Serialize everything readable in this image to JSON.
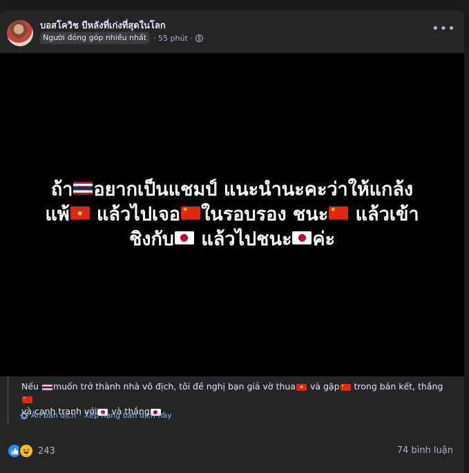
{
  "post": {
    "author": "บอสโควิช บีหลังที่เก่งที่สุดในโลก",
    "badge": "Người đóng góp nhiều nhất",
    "time": "· 55 phút ·",
    "more_label": "•••"
  },
  "image_text": {
    "line1_a": "ถ้า",
    "line1_b": "อยากเป็นแชมป์ แนะนำนะคะว่าให้แกล้ง",
    "line2_a": "แพ้",
    "line2_b": " แล้วไปเจอ",
    "line2_c": "ในรอบรอง ชนะ",
    "line2_d": " แล้วเข้า",
    "line3_a": "ชิงกับ",
    "line3_b": " แล้วไปชนะ",
    "line3_c": "ค่ะ"
  },
  "translation": {
    "t1": "Nếu ",
    "t2": "muốn trở thành nhà vô địch, tôi đề nghị bạn giả vờ thua",
    "t3": " và gặp",
    "t4": " trong bán kết, thắng",
    "t5": "và cạnh tranh với",
    "t6": " và thắng",
    "t7": ".",
    "see_original": "Ẩn bản dịch",
    "separator": "·",
    "rate": "Xếp hạng bản dịch này"
  },
  "footer": {
    "reaction_count": "243",
    "comments": "74 bình luận"
  },
  "icons": {
    "like": "like-icon",
    "haha": "haha-icon",
    "globe": "globe-icon",
    "gear": "gear-icon"
  },
  "colors": {
    "background": "#18191a",
    "card": "#242526",
    "link": "#8ab4f8",
    "like_blue": "#2d88ff"
  }
}
